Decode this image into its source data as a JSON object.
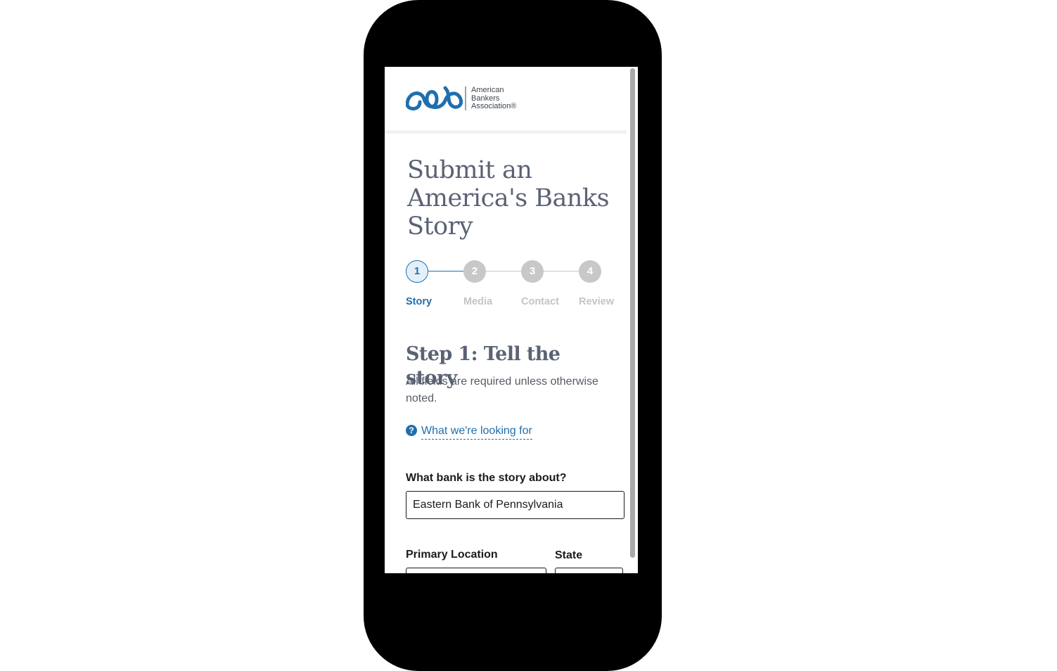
{
  "header": {
    "logo_line1": "American",
    "logo_line2": "Bankers",
    "logo_line3": "Association®"
  },
  "page_title": "Submit an America's Banks Story",
  "stepper": {
    "steps": [
      {
        "number": "1",
        "label": "Story"
      },
      {
        "number": "2",
        "label": "Media"
      },
      {
        "number": "3",
        "label": "Contact"
      },
      {
        "number": "4",
        "label": "Review"
      }
    ],
    "active_step": 1
  },
  "step_heading": "Step 1: Tell the story",
  "step_description": "All fields are required unless otherwise noted.",
  "help_link": "What we're looking for",
  "form": {
    "bank_label": "What bank is the story about?",
    "bank_value": "Eastern Bank of Pennsylvania",
    "location_label": "Primary Location",
    "location_value": "",
    "state_label": "State",
    "state_value": ""
  },
  "colors": {
    "accent": "#1f6fae",
    "title": "#5a6274",
    "inactive_step": "#c8c8c8",
    "phone_frame": "#000000"
  },
  "icons": {
    "help": "question-circle-icon"
  }
}
